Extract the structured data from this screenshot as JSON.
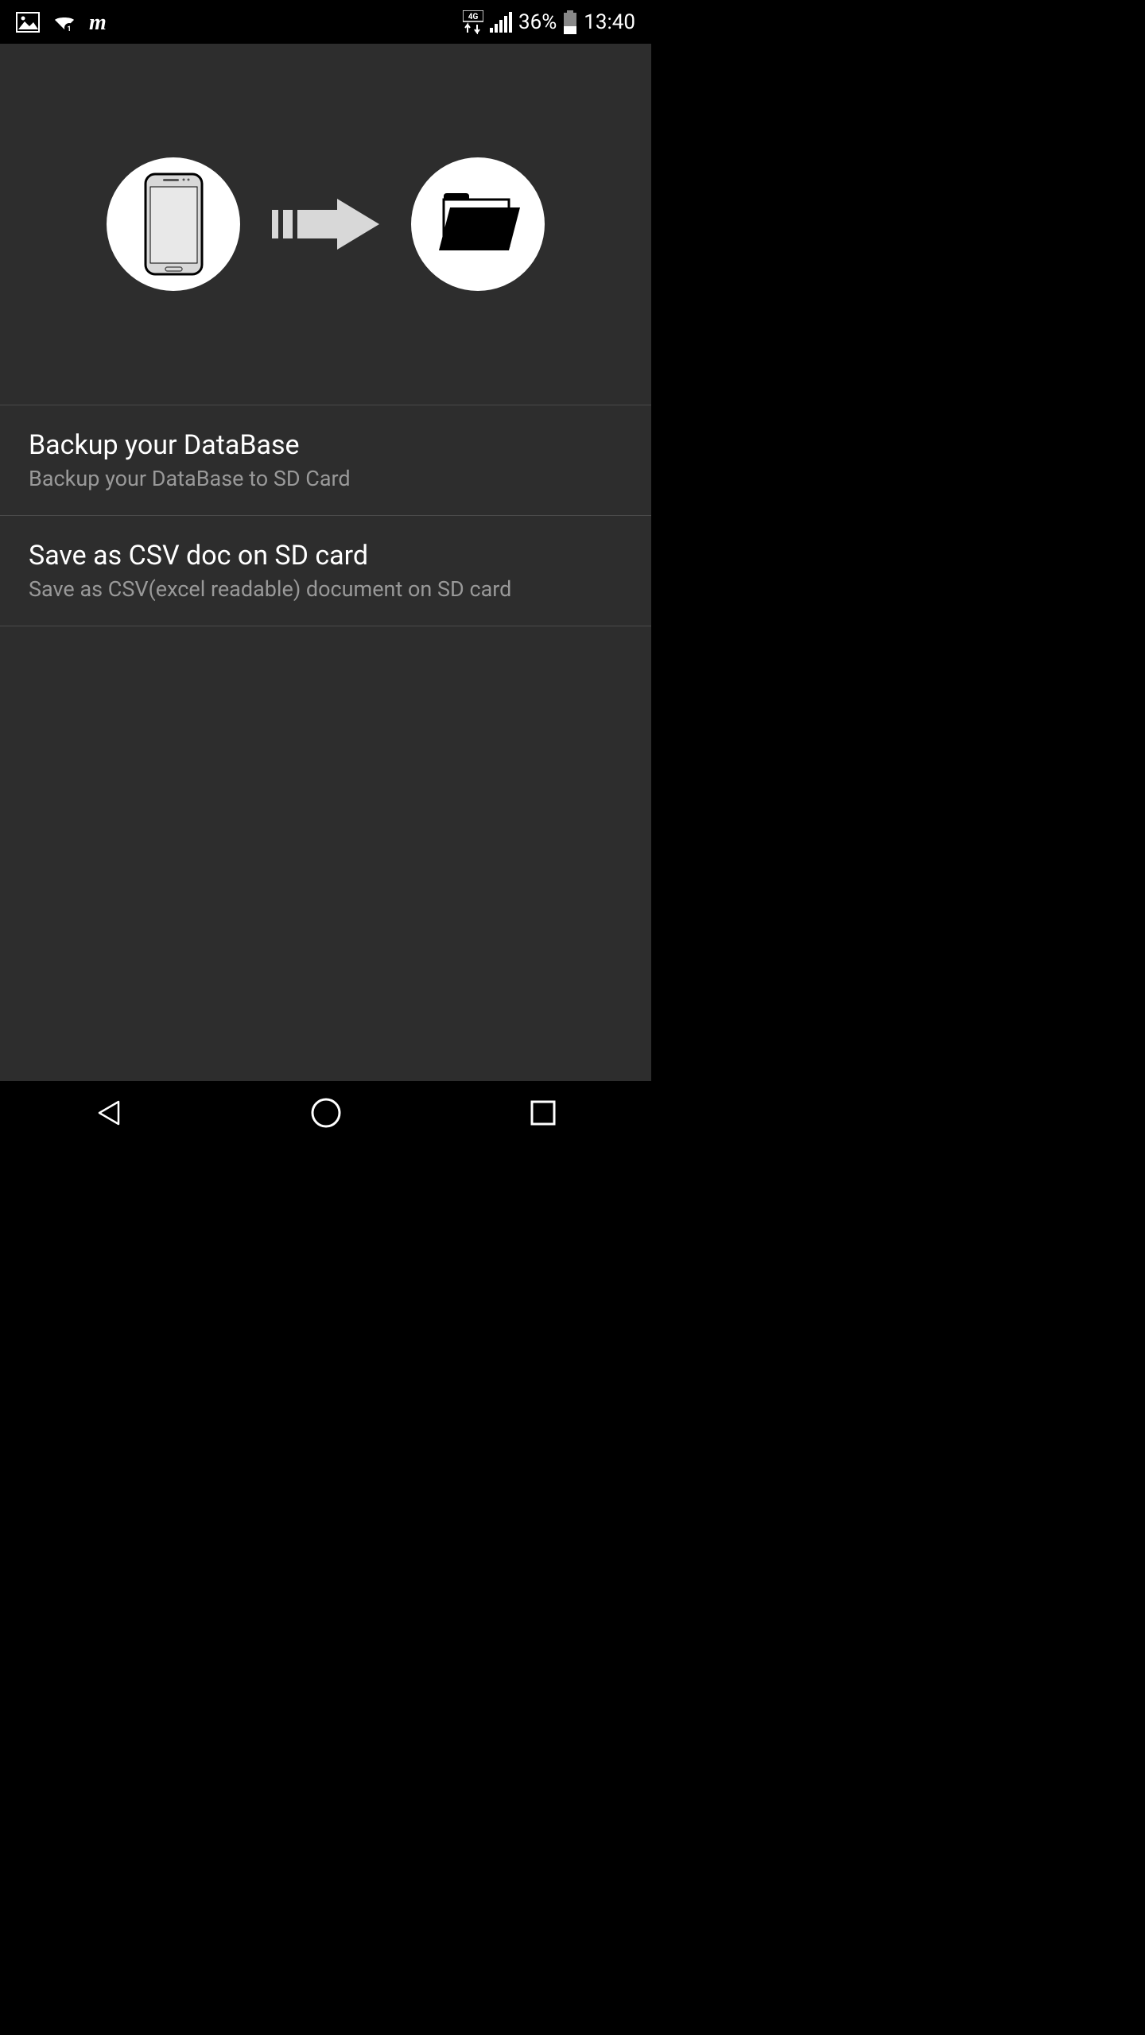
{
  "status_bar": {
    "battery_percent": "36%",
    "time": "13:40",
    "network_type": "4G"
  },
  "list_items": [
    {
      "title": "Backup your DataBase",
      "subtitle": "Backup your DataBase to SD Card"
    },
    {
      "title": "Save as CSV doc on SD card",
      "subtitle": "Save as CSV(excel readable) document on SD card"
    }
  ]
}
